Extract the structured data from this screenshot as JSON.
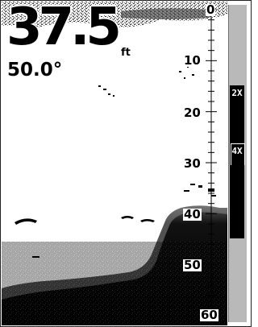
{
  "readout": {
    "depth": "37.5",
    "depth_unit": "ft",
    "temperature": "50.0°"
  },
  "scale": {
    "labels": [
      "0",
      "10",
      "20",
      "30",
      "40",
      "50",
      "60"
    ],
    "max_depth": 60
  },
  "zoom": {
    "levels": [
      "2X",
      "4X"
    ]
  },
  "colors": {
    "water": "#ffffff",
    "bottom": "#000000",
    "scroll_track": "#b9b9b9",
    "zoom_bar": "#000000"
  }
}
